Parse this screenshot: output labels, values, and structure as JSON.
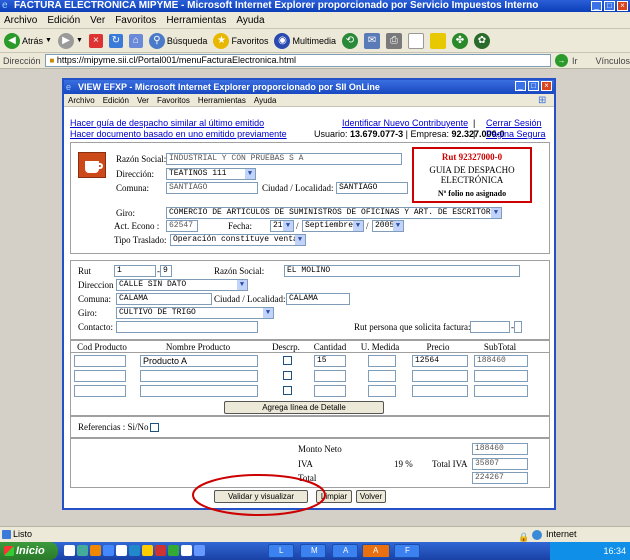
{
  "window": {
    "title": "FACTURA ELECTRONICA MIPYME - Microsoft Internet Explorer proporcionado por Servicio Impuestos Interno"
  },
  "menubar": [
    "Archivo",
    "Edición",
    "Ver",
    "Favoritos",
    "Herramientas",
    "Ayuda"
  ],
  "toolbar": {
    "back": "Atrás",
    "search": "Búsqueda",
    "favorites": "Favoritos",
    "multimedia": "Multimedia"
  },
  "address": {
    "label": "Dirección",
    "url": "https://mipyme.sii.cl/Portal001/menuFacturaElectronica.html",
    "go": "Ir",
    "links": "Vínculos"
  },
  "popup": {
    "title": "VIEW EFXP - Microsoft Internet Explorer proporcionado por SII OnLine",
    "menu": [
      "Archivo",
      "Edición",
      "Ver",
      "Favoritos",
      "Herramientas",
      "Ayuda"
    ],
    "links": {
      "similar": "Hacer guía de despacho similar al último emitido",
      "based_prev": "Hacer documento basado en uno emitido previamente",
      "identify": "Identificar Nuevo Contribuyente",
      "sep": "|",
      "close": "Cerrar Sesión",
      "safe_exit": "Página Segura"
    },
    "user_info": {
      "usuario_label": "Usuario:",
      "usuario": "13.679.077-3",
      "empresa_label": "Empresa:",
      "empresa": "92.327.000-0"
    },
    "doc_box": {
      "rut": "Rut 92327000-0",
      "type_line1": "GUIA DE DESPACHO",
      "type_line2": "ELECTRÓNICA",
      "folio": "Nº folio no asignado"
    },
    "emisor": {
      "razon_social_label": "Razón Social:",
      "razon_social": "INDUSTRIAL Y CON PRUEBAS S A",
      "direccion_label": "Dirección:",
      "direccion": "TEATINOS 111",
      "comuna_label": "Comuna:",
      "comuna": "SANTIAGO",
      "ciudad_label": "Ciudad / Localidad:",
      "ciudad": "SANTIAGO",
      "giro_label": "Giro:",
      "giro": "COMERCIO DE ARTICULOS DE SUMINISTROS DE OFICINAS Y ART. DE ESCRITORIO",
      "acteco_label": "Act. Econo :",
      "acteco": "62547",
      "fecha_label": "Fecha:",
      "dia": "21",
      "slash": "/",
      "mes": "Septiembre",
      "anio": "2005",
      "traslado_label": "Tipo Traslado:",
      "traslado": "Operación constituye venta"
    },
    "receptor": {
      "rut_label": "Rut",
      "rut": "1",
      "dv": "9",
      "razon_label": "Razón Social:",
      "razon": "EL MOLINO",
      "direccion_label": "Direccion",
      "direccion": "CALLE SIN DATO",
      "comuna_label": "Comuna:",
      "comuna": "CALAMA",
      "ciudad_label": "Ciudad / Localidad:",
      "ciudad": "CALAMA",
      "giro_label": "Giro:",
      "giro": "CULTIVO DE TRIGO",
      "contacto_label": "Contacto:",
      "contacto": "",
      "rut_solicita_label": "Rut persona que solicita factura:"
    },
    "detalle": {
      "headers": [
        "Cod Producto",
        "Nombre Producto",
        "Descrp.",
        "Cantidad",
        "U. Medida",
        "Precio",
        "SubTotal"
      ],
      "rows": [
        {
          "cod": "",
          "nombre": "Producto A",
          "cantidad": "15",
          "medida": "",
          "precio": "12564",
          "subtotal": "188460"
        },
        {
          "cod": "",
          "nombre": "",
          "cantidad": "",
          "medida": "",
          "precio": "",
          "subtotal": ""
        },
        {
          "cod": "",
          "nombre": "",
          "cantidad": "",
          "medida": "",
          "precio": "",
          "subtotal": ""
        }
      ],
      "add_line": "Agrega línea de Detalle"
    },
    "referencias_label": "Referencias : Si/No",
    "totales": {
      "neto_label": "Monto Neto",
      "neto": "188460",
      "iva_label": "IVA",
      "iva_pct": "19 %",
      "total_iva_label": "Total IVA",
      "total_iva": "35807",
      "total_label": "Total",
      "total": "224267"
    },
    "buttons": {
      "validar": "Validar y visualizar",
      "limpiar": "Limpiar",
      "volver": "Volver"
    }
  },
  "status": {
    "text": "Listo",
    "zone": "Internet"
  },
  "taskbar": {
    "start": "Inicio",
    "items": [
      "L",
      "M",
      "A",
      "A",
      "F"
    ],
    "clock": "16:34"
  },
  "colors": {
    "title_blue": "#0a3fb8",
    "link_blue": "#0000cc",
    "highlight_red": "#cc0000"
  }
}
